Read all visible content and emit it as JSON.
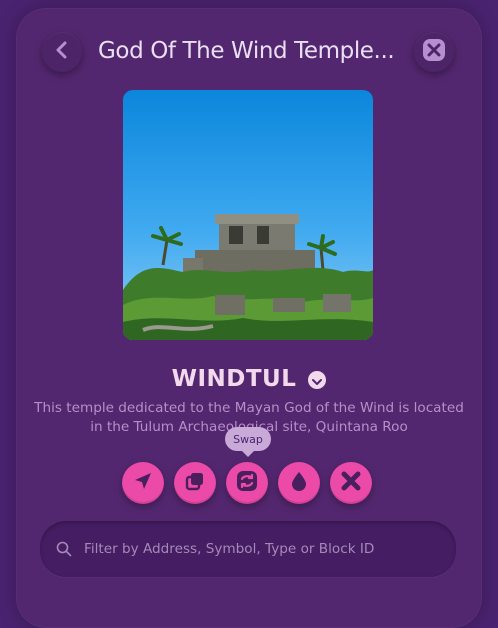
{
  "header": {
    "title": "God Of The Wind Temple..."
  },
  "token": {
    "name": "WINDTUL",
    "description": "This temple dedicated to the Mayan God of the Wind is located in the Tulum Archaeological site, Quintana Roo"
  },
  "actions": {
    "tooltip": "Swap",
    "items": [
      {
        "icon": "send-icon"
      },
      {
        "icon": "copy-icon"
      },
      {
        "icon": "swap-icon"
      },
      {
        "icon": "drop-icon"
      },
      {
        "icon": "burn-icon"
      }
    ]
  },
  "search": {
    "placeholder": "Filter by Address, Symbol, Type or Block ID",
    "value": ""
  },
  "colors": {
    "background": "#4a2370",
    "panel": "#53276f",
    "accent": "#ec4aa8",
    "text": "#eadff2"
  }
}
